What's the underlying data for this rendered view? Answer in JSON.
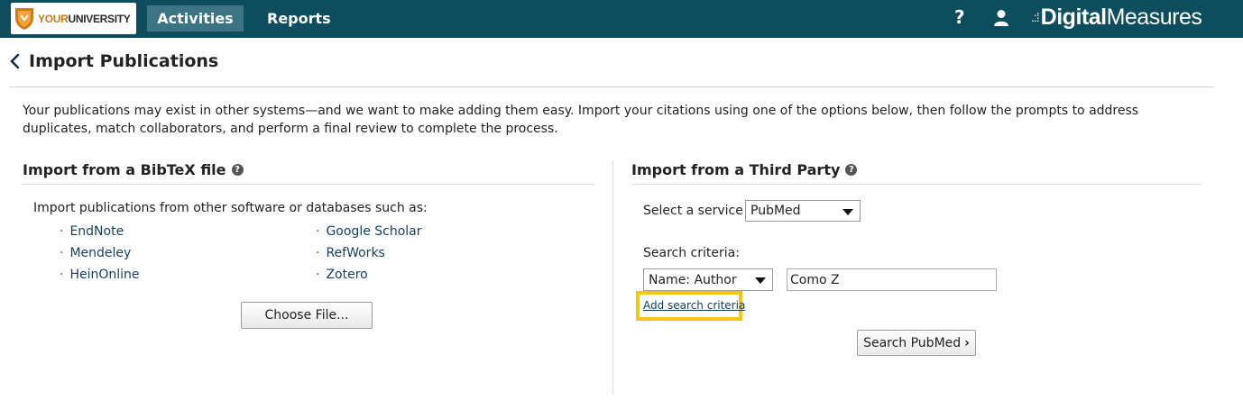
{
  "header": {
    "logo": {
      "text_prefix": "YOUR",
      "text_suffix": "UNIVERSITY"
    },
    "nav": [
      {
        "label": "Activities",
        "active": true
      },
      {
        "label": "Reports",
        "active": false
      }
    ],
    "help_label": "?",
    "brand": {
      "prefix": "Digital",
      "suffix": "Measures"
    },
    "colors": {
      "bar": "#0d4d5e",
      "active_tab": "#3d7484"
    }
  },
  "page": {
    "title": "Import Publications",
    "intro": "Your publications may exist in other systems—and we want to make adding them easy. Import your citations using one of the options below, then follow the prompts to address duplicates, match collaborators, and perform a final review to complete the process."
  },
  "bibtex": {
    "heading": "Import from a BibTeX file",
    "lead": "Import publications from other software or databases such as:",
    "sources_left": [
      "EndNote",
      "Mendeley",
      "HeinOnline"
    ],
    "sources_right": [
      "Google Scholar",
      "RefWorks",
      "Zotero"
    ],
    "choose_file_label": "Choose File..."
  },
  "third_party": {
    "heading": "Import from a Third Party",
    "service_label": "Select a service",
    "service_value": "PubMed",
    "criteria_label": "Search criteria:",
    "criteria_field_value": "Name: Author",
    "criteria_input_value": "Como Z",
    "add_criteria_link": "Add search criteria",
    "search_button_label": "Search PubMed",
    "search_button_chevron": "›"
  }
}
